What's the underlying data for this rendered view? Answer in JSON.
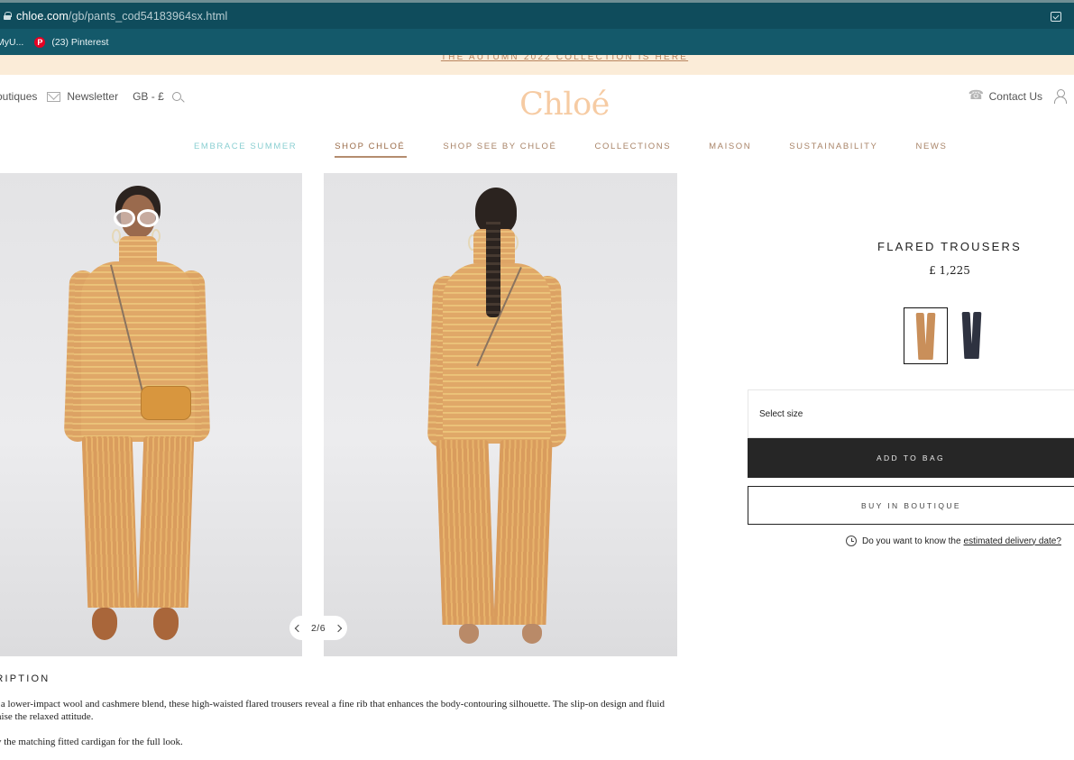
{
  "browser": {
    "url_host": "chloe.com",
    "url_path": "/gb/pants_cod54183964sx.html",
    "bookmarks": [
      {
        "label": "MyU..."
      },
      {
        "label": "(23) Pinterest"
      }
    ]
  },
  "promo": {
    "text": "THE AUTUMN 2022 COLLECTION IS HERE"
  },
  "header": {
    "left": {
      "boutiques": "Boutiques",
      "newsletter": "Newsletter",
      "locale": "GB - £"
    },
    "logo": "Chloé",
    "right": {
      "contact": "Contact Us"
    }
  },
  "nav": [
    {
      "label": "EMBRACE SUMMER"
    },
    {
      "label": "SHOP CHLOÉ"
    },
    {
      "label": "SHOP SEE BY CHLOÉ"
    },
    {
      "label": "COLLECTIONS"
    },
    {
      "label": "MAISON"
    },
    {
      "label": "SUSTAINABILITY"
    },
    {
      "label": "NEWS"
    }
  ],
  "gallery": {
    "pager": "2/6",
    "current": 2,
    "total": 6
  },
  "product": {
    "title": "FLARED TROUSERS",
    "price": "£ 1,225",
    "swatches": [
      {
        "name": "camel",
        "color": "#c98f5a",
        "selected": true
      },
      {
        "name": "navy",
        "color": "#2e3240",
        "selected": false
      }
    ],
    "size_placeholder": "Select size",
    "add_to_bag": "ADD TO BAG",
    "buy_in_boutique": "BUY IN BOUTIQUE",
    "delivery_question": "Do you want to know the",
    "delivery_link": "estimated delivery date?"
  },
  "description": {
    "title": "DESCRIPTION",
    "line1": "In a lower-impact wool and cashmere blend, these high-waisted flared trousers reveal a fine rib that enhances the body-contouring silhouette. The slip-on design and fluid",
    "line2": "raise the relaxed attitude.",
    "line3": "Try the matching fitted cardigan for the full look."
  },
  "colors": {
    "browser_bar": "#0f4c5c",
    "promo_bg": "#fbecd8",
    "logo": "#f6cba3",
    "nav_accent": "#a98468",
    "button_dark": "#262626"
  }
}
